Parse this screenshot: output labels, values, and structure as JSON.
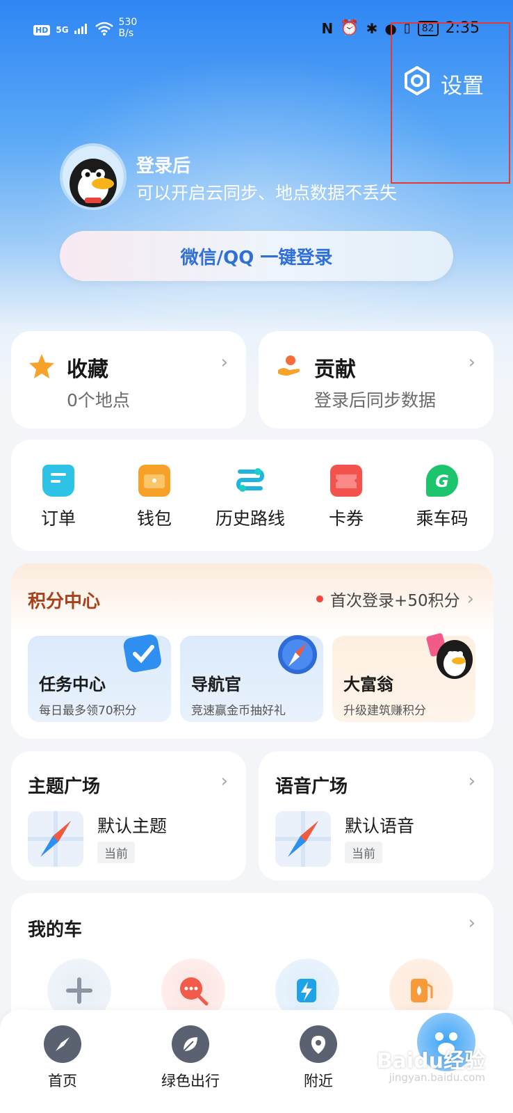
{
  "status": {
    "hd": "HD",
    "signal": "5G",
    "speed_value": "530",
    "speed_unit": "B/s",
    "battery": "82",
    "time": "2:35"
  },
  "settings": {
    "label": "设置"
  },
  "login": {
    "title": "登录后",
    "subtitle": "可以开启云同步、地点数据不丢失",
    "button": "微信/QQ 一键登录"
  },
  "favorites": {
    "title": "收藏",
    "subtitle": "0个地点"
  },
  "contribution": {
    "title": "贡献",
    "subtitle": "登录后同步数据"
  },
  "tools": [
    {
      "label": "订单",
      "icon": "order-icon",
      "color": "#2ec3e6"
    },
    {
      "label": "钱包",
      "icon": "wallet-icon",
      "color": "#f7a128"
    },
    {
      "label": "历史路线",
      "icon": "route-icon",
      "color": "#1fb3e0"
    },
    {
      "label": "卡券",
      "icon": "coupon-icon",
      "color": "#f4524d"
    },
    {
      "label": "乘车码",
      "icon": "ride-code-icon",
      "color": "#1bc46d"
    }
  ],
  "points": {
    "title": "积分中心",
    "promo": "首次登录+50积分",
    "cards": [
      {
        "title": "任务中心",
        "subtitle": "每日最多领70积分"
      },
      {
        "title": "导航官",
        "subtitle": "竞速赢金币抽好礼"
      },
      {
        "title": "大富翁",
        "subtitle": "升级建筑赚积分"
      }
    ]
  },
  "theme": {
    "title": "主题广场",
    "item": "默认主题",
    "tag": "当前"
  },
  "voice": {
    "title": "语音广场",
    "item": "默认语音",
    "tag": "当前"
  },
  "car": {
    "title": "我的车"
  },
  "nav": [
    {
      "label": "首页"
    },
    {
      "label": "绿色出行"
    },
    {
      "label": "附近"
    }
  ],
  "watermark": {
    "main": "Baidu经验",
    "sub": "jingyan.baidu.com"
  }
}
